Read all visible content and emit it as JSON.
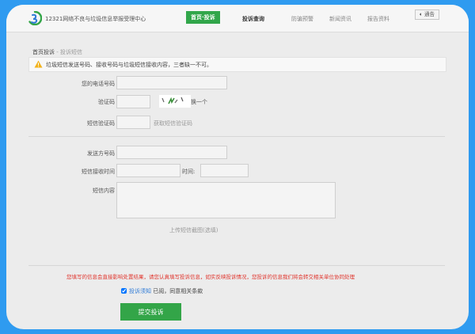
{
  "header": {
    "site_title": "12321网络不良与垃圾信息举报受理中心",
    "nav": [
      "首页·投诉",
      "投诉查询",
      "防骗预警",
      "新闻资讯",
      "报告资料"
    ],
    "notice_button": "通告"
  },
  "breadcrumb": {
    "home": "首页投诉",
    "separator": " - ",
    "current": "投诉短信"
  },
  "warning": "垃圾短信发送号码、接收号码与垃圾短信接收内容，三者缺一不可。",
  "form": {
    "phone_label": "您的电话号码",
    "captcha_label": "验证码",
    "captcha_refresh": "换一个",
    "sms_code_label": "短信验证码",
    "sms_code_link": "获取短信验证码",
    "sender_label": "发送方号码",
    "receive_date_label": "短信接收时间",
    "receive_time_label": "时间:",
    "content_label": "短信内容",
    "upload_link": "上传短信截图(选填)"
  },
  "note": "您填写的信息会直接影响处置结果，请您认真填写投诉信息，如实反映投诉情况，您投诉的信息我们将会转交相关单位协同处理",
  "agreement": {
    "checked": true,
    "link": "投诉须知",
    "text": "已阅，同意相关条款"
  },
  "submit_label": "提交投诉",
  "colors": {
    "brand_green": "#31a64a",
    "link_blue": "#2f7bd6",
    "warning_red": "#e0332b",
    "outer_blue": "#2f9bf0"
  }
}
